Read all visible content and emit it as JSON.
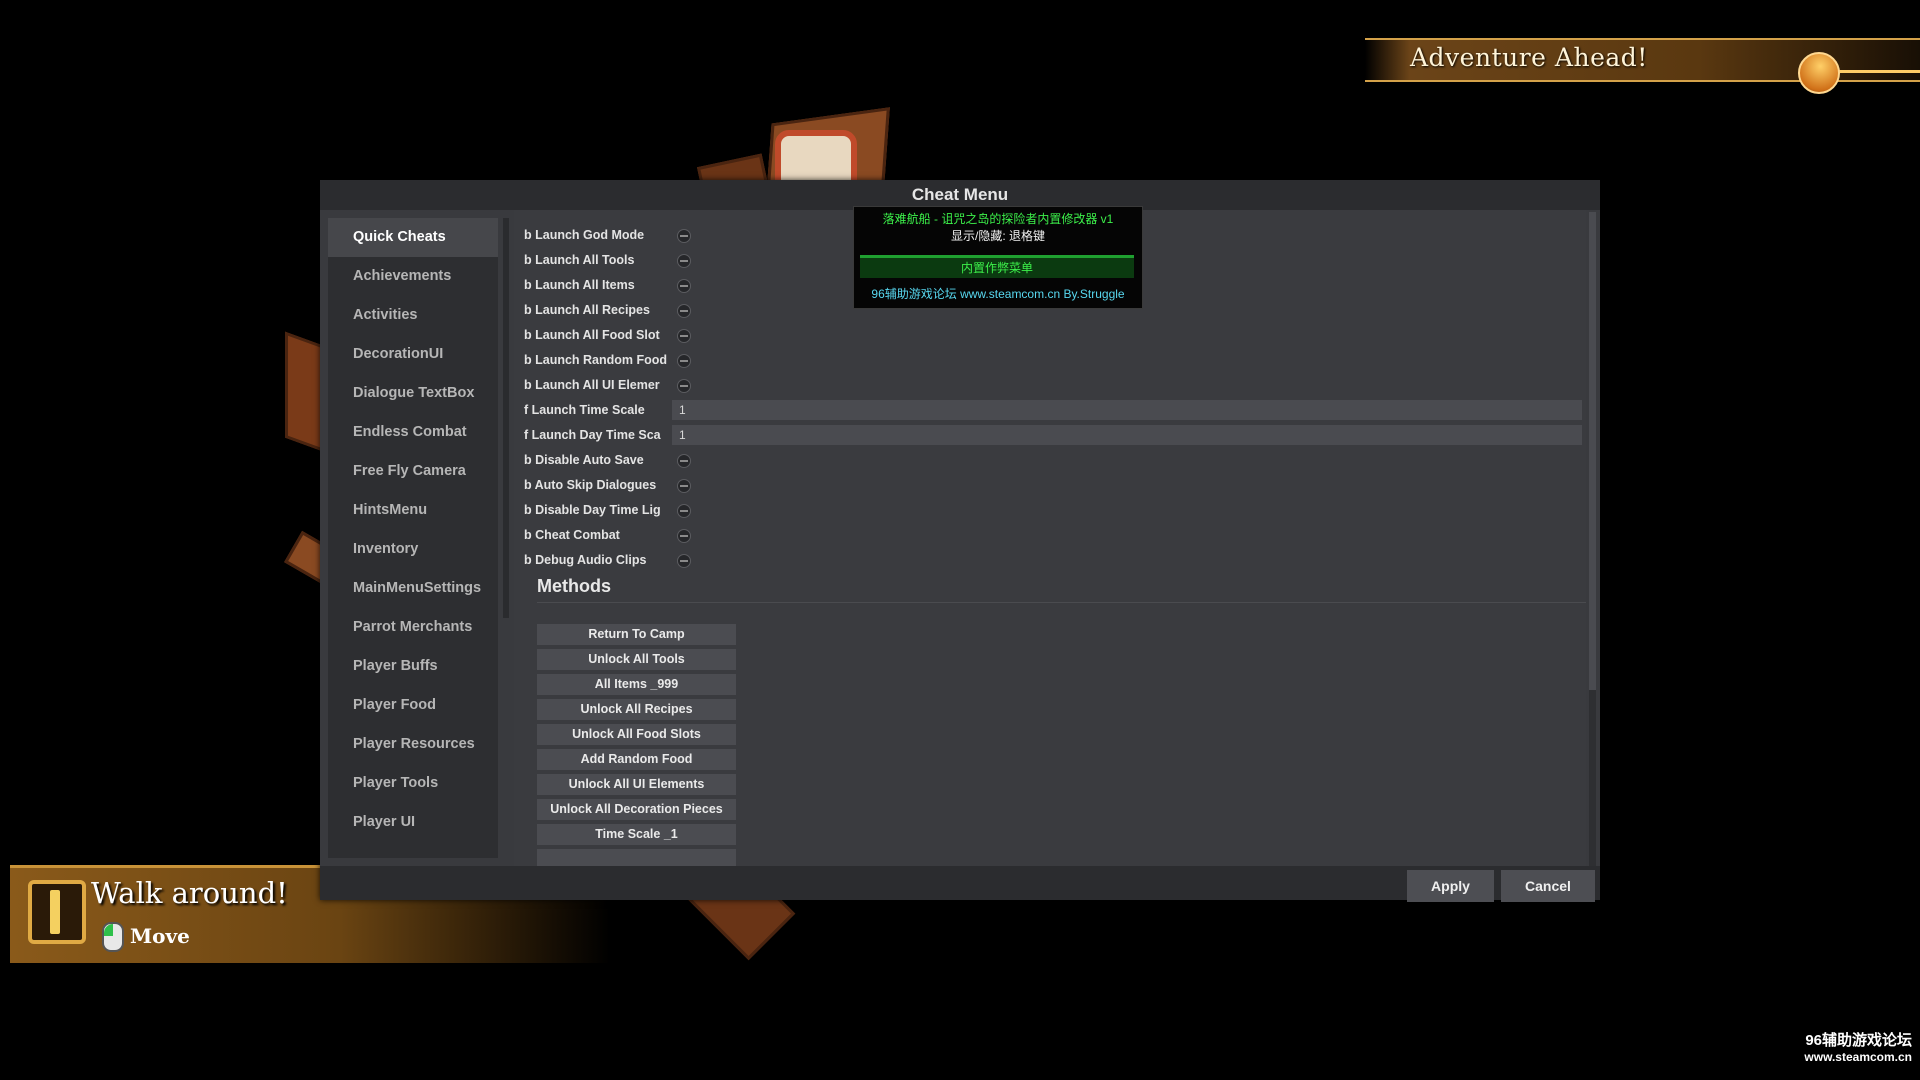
{
  "quest_banner": {
    "title": "Adventure Ahead!"
  },
  "task_banner": {
    "title": "Walk around!",
    "action": "Move"
  },
  "cheat_menu": {
    "title": "Cheat Menu",
    "sidebar": [
      "Quick Cheats",
      "Achievements",
      "Activities",
      "DecorationUI",
      "Dialogue TextBox",
      "Endless Combat",
      "Free Fly Camera",
      "HintsMenu",
      "Inventory",
      "MainMenuSettings",
      "Parrot Merchants",
      "Player Buffs",
      "Player Food",
      "Player Resources",
      "Player Tools",
      "Player UI"
    ],
    "active_tab": "Quick Cheats",
    "properties": [
      {
        "label": "b Launch God Mode",
        "type": "toggle"
      },
      {
        "label": "b Launch All Tools",
        "type": "toggle"
      },
      {
        "label": "b Launch All Items",
        "type": "toggle"
      },
      {
        "label": "b Launch All Recipes",
        "type": "toggle"
      },
      {
        "label": "b Launch All Food Slot",
        "type": "toggle"
      },
      {
        "label": "b Launch Random Food",
        "type": "toggle"
      },
      {
        "label": "b Launch All UI Elemer",
        "type": "toggle"
      },
      {
        "label": "f Launch Time Scale",
        "type": "number",
        "value": "1"
      },
      {
        "label": "f Launch Day Time Sca",
        "type": "number",
        "value": "1"
      },
      {
        "label": "b Disable Auto Save",
        "type": "toggle"
      },
      {
        "label": "b Auto Skip Dialogues",
        "type": "toggle"
      },
      {
        "label": "b Disable Day Time Lig",
        "type": "toggle"
      },
      {
        "label": "b Cheat Combat",
        "type": "toggle"
      },
      {
        "label": "b Debug Audio Clips",
        "type": "toggle"
      }
    ],
    "methods_heading": "Methods",
    "methods": [
      "Return To Camp",
      "Unlock All Tools",
      "All Items _999",
      "Unlock All Recipes",
      "Unlock All Food Slots",
      "Add Random Food",
      "Unlock All UI Elements",
      "Unlock All Decoration Pieces",
      "Time Scale _1"
    ],
    "apply_label": "Apply",
    "cancel_label": "Cancel"
  },
  "trainer_overlay": {
    "title": "落难航船 - 诅咒之岛的探险者内置修改器 v1",
    "hotkey": "显示/隐藏: 退格键",
    "menu_button": "内置作弊菜单",
    "link": "96辅助游戏论坛 www.steamcom.cn By.Struggle"
  },
  "watermark": {
    "line1": "96辅助游戏论坛",
    "line2": "www.steamcom.cn"
  },
  "colors": {
    "window_bg": "#393a3e",
    "sidebar_bg": "#2d2e31",
    "active_tab_bg": "#46474b",
    "button_bg": "#4b4c51",
    "trainer_green": "#3cf04a",
    "trainer_cyan": "#58d8f0",
    "quest_gold": "#d4a24a"
  },
  "icons": [
    "exclamation-icon",
    "mouse-icon",
    "quest-gem-icon",
    "toggle-icon"
  ]
}
